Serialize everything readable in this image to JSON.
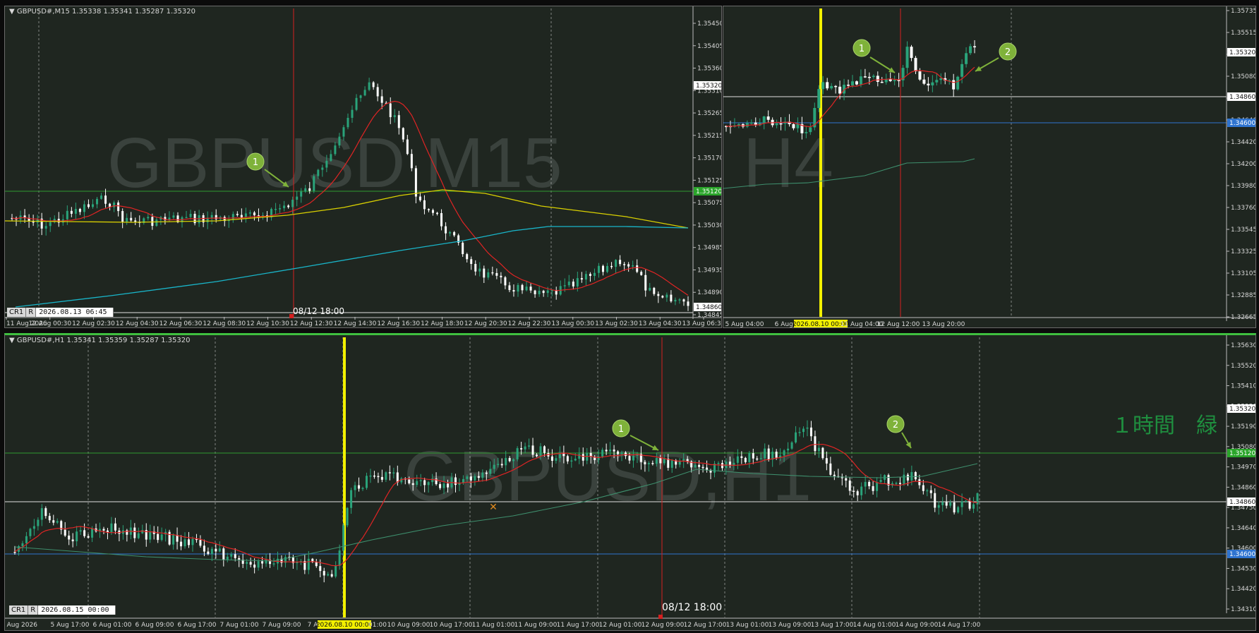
{
  "colors": {
    "background": "#1f2620",
    "grid": "#cfcfcf",
    "bull": "#2aa37a",
    "bear": "#ffffff",
    "ma_red": "#e02424",
    "ma_yellow": "#d9d000",
    "ma_cyan": "#19b5c9",
    "ma_green": "#3e8f6d",
    "hline_green": "#2f9a2f",
    "hline_white": "#e0e0e0",
    "hline_blue": "#2f74d0",
    "vline_red": "#d42020",
    "vline_yellow": "#f2f000",
    "marker": "#7fb23a"
  },
  "m15": {
    "header": "GBPUSD#,M15  1.35338 1.35341 1.35287 1.35320",
    "watermark": "GBPUSD M15",
    "status": {
      "tag1": "CR1",
      "tag2": "R",
      "datetime": "2026.08.13 06:45"
    },
    "vline_label": "08/12 18:00",
    "price_labels": [
      "1.35450",
      "1.35405",
      "1.35360",
      "1.35310",
      "1.35265",
      "1.35215",
      "1.35170",
      "1.35125",
      "1.35075",
      "1.35030",
      "1.34985",
      "1.34935",
      "1.34890",
      "1.34845"
    ],
    "price_tags": {
      "current": "1.35320",
      "green_line": "1.35120",
      "white_line": "1.34860"
    },
    "time_labels": [
      "11 Aug 2026",
      "12 Aug 00:30",
      "12 Aug 02:30",
      "12 Aug 04:30",
      "12 Aug 06:30",
      "12 Aug 08:30",
      "12 Aug 10:30",
      "12 Aug 12:30",
      "12 Aug 14:30",
      "12 Aug 16:30",
      "12 Aug 18:30",
      "12 Aug 20:30",
      "12 Aug 22:30",
      "13 Aug 00:30",
      "13 Aug 02:30",
      "13 Aug 04:30",
      "13 Aug 06:30"
    ],
    "markers": [
      "1"
    ]
  },
  "h4": {
    "watermark": "H4",
    "price_labels": [
      "1.35735",
      "1.35515",
      "1.35320",
      "1.35080",
      "1.34860",
      "1.34640",
      "1.34420",
      "1.34200",
      "1.33980",
      "1.33760",
      "1.33545",
      "1.33325",
      "1.33105",
      "1.32885",
      "1.32665"
    ],
    "price_tags": {
      "current": "1.35320",
      "white_line": "1.34860",
      "blue_line": "1.34600"
    },
    "time_labels": [
      "5 Aug 04:00",
      "6 Aug 1",
      "2026.08.10 00:00",
      "11 Aug 04:00",
      "12 Aug 12:00",
      "13 Aug 20:00"
    ],
    "markers": [
      "1",
      "2"
    ]
  },
  "h1": {
    "header": "GBPUSD#,H1  1.35341 1.35359 1.35287 1.35320",
    "watermark": "GBPUSD,H1",
    "annotation": "１時間　緑",
    "status": {
      "tag1": "CR1",
      "tag2": "R",
      "datetime": "2026.08.15 00:00"
    },
    "vline_label": "08/12 18:00",
    "price_labels": [
      "1.35630",
      "1.35520",
      "1.35410",
      "1.35320",
      "1.35190",
      "1.35080",
      "1.34970",
      "1.34860",
      "1.34750",
      "1.34640",
      "1.34600",
      "1.34530",
      "1.34420",
      "1.34310"
    ],
    "price_tags": {
      "current": "1.35320",
      "green_line": "1.35120",
      "white_line": "1.34860",
      "blue_line": "1.34600"
    },
    "time_labels": [
      "5 Aug 2026",
      "5 Aug 17:00",
      "6 Aug 01:00",
      "6 Aug 09:00",
      "6 Aug 17:00",
      "7 Aug 01:00",
      "7 Aug 09:00",
      "7 A",
      "2026.08.10 00:00",
      "01:00",
      "10 Aug 09:00",
      "10 Aug 17:00",
      "11 Aug 01:00",
      "11 Aug 09:00",
      "11 Aug 17:00",
      "12 Aug 01:00",
      "12 Aug 09:00",
      "12 Aug 17:00",
      "13 Aug 01:00",
      "13 Aug 09:00",
      "13 Aug 17:00",
      "14 Aug 01:00",
      "14 Aug 09:00",
      "14 Aug 17:00"
    ],
    "markers": [
      "1",
      "2"
    ]
  }
}
